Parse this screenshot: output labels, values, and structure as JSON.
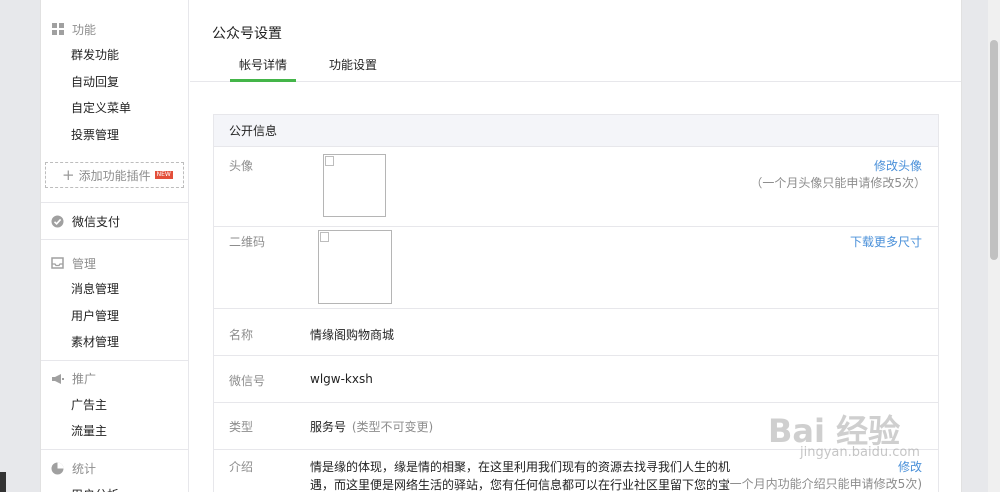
{
  "sidebar": {
    "feature_title": "功能",
    "feature_items": [
      "群发功能",
      "自动回复",
      "自定义菜单",
      "投票管理"
    ],
    "plugin_label": "添加功能插件",
    "plugin_badge": "NEW",
    "pay_title": "微信支付",
    "manage_title": "管理",
    "manage_items": [
      "消息管理",
      "用户管理",
      "素材管理"
    ],
    "promo_title": "推广",
    "promo_items": [
      "广告主",
      "流量主"
    ],
    "stats_title": "统计",
    "stats_items": [
      "用户分析"
    ]
  },
  "main": {
    "title": "公众号设置",
    "tabs": [
      {
        "label": "帐号详情",
        "active": true
      },
      {
        "label": "功能设置",
        "active": false
      }
    ],
    "card_title": "公开信息",
    "avatar": {
      "label": "头像",
      "link": "修改头像",
      "note": "（一个月头像只能申请修改5次）"
    },
    "qrcode": {
      "label": "二维码",
      "link": "下载更多尺寸"
    },
    "name": {
      "label": "名称",
      "value": "情缘阁购物商城"
    },
    "wechat_id": {
      "label": "微信号",
      "value": "wlgw-kxsh"
    },
    "type": {
      "label": "类型",
      "value": "服务号",
      "note": "(类型不可变更)"
    },
    "intro": {
      "label": "介绍",
      "value": "情是缘的体现，缘是情的相聚，在这里利用我们现有的资源去找寻我们人生的机遇，而这里便是网络生活的驿站，您有任何信息都可以在行业社区里留下您的宝贵意",
      "link": "修改",
      "note": "(一个月内功能介绍只能申请修改5次)"
    }
  },
  "watermark": {
    "main": "Bai 经验",
    "sub": "jingyan.baidu.com"
  },
  "colors": {
    "accent": "#44b549",
    "link": "#4a90d9",
    "badge": "#e34f3a"
  }
}
